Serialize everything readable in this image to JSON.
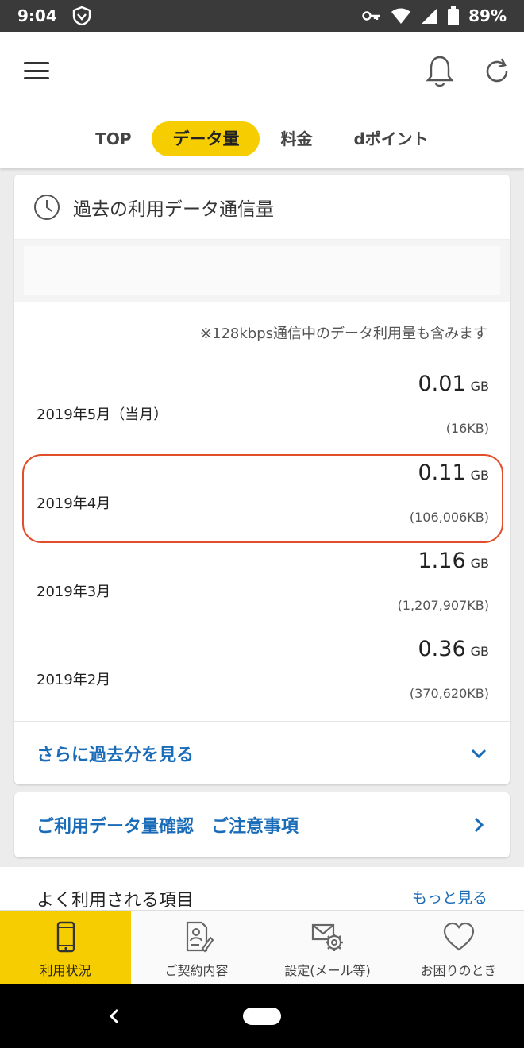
{
  "status": {
    "time": "9:04",
    "battery": "89%"
  },
  "header": {
    "icons": [
      "menu-icon",
      "bell-icon",
      "refresh-icon"
    ],
    "tabs": [
      {
        "label": "TOP",
        "active": false
      },
      {
        "label": "データ量",
        "active": true
      },
      {
        "label": "料金",
        "active": false
      },
      {
        "label": "dポイント",
        "active": false
      }
    ]
  },
  "history": {
    "title": "過去の利用データ通信量",
    "note": "※128kbps通信中のデータ利用量も含みます",
    "rows": [
      {
        "month": "2019年5月（当月）",
        "amount": "0.01",
        "unit": "GB",
        "kb": "(16KB)"
      },
      {
        "month": "2019年4月",
        "amount": "0.11",
        "unit": "GB",
        "kb": "(106,006KB)"
      },
      {
        "month": "2019年3月",
        "amount": "1.16",
        "unit": "GB",
        "kb": "(1,207,907KB)"
      },
      {
        "month": "2019年2月",
        "amount": "0.36",
        "unit": "GB",
        "kb": "(370,620KB)"
      }
    ],
    "more_label": "さらに過去分を見る"
  },
  "notice": {
    "label": "ご利用データ量確認　ご注意事項"
  },
  "frequent": {
    "title": "よく利用される項目",
    "link": "もっと見る"
  },
  "bottom_nav": [
    {
      "label": "利用状況",
      "icon": "phone-icon",
      "active": true
    },
    {
      "label": "ご契約内容",
      "icon": "contract-icon",
      "active": false
    },
    {
      "label": "設定(メール等)",
      "icon": "mail-settings-icon",
      "active": false
    },
    {
      "label": "お困りのとき",
      "icon": "heart-icon",
      "active": false
    }
  ],
  "colors": {
    "accent": "#f6cd00",
    "link": "#1a6cb8",
    "highlight": "#e24e2a"
  }
}
